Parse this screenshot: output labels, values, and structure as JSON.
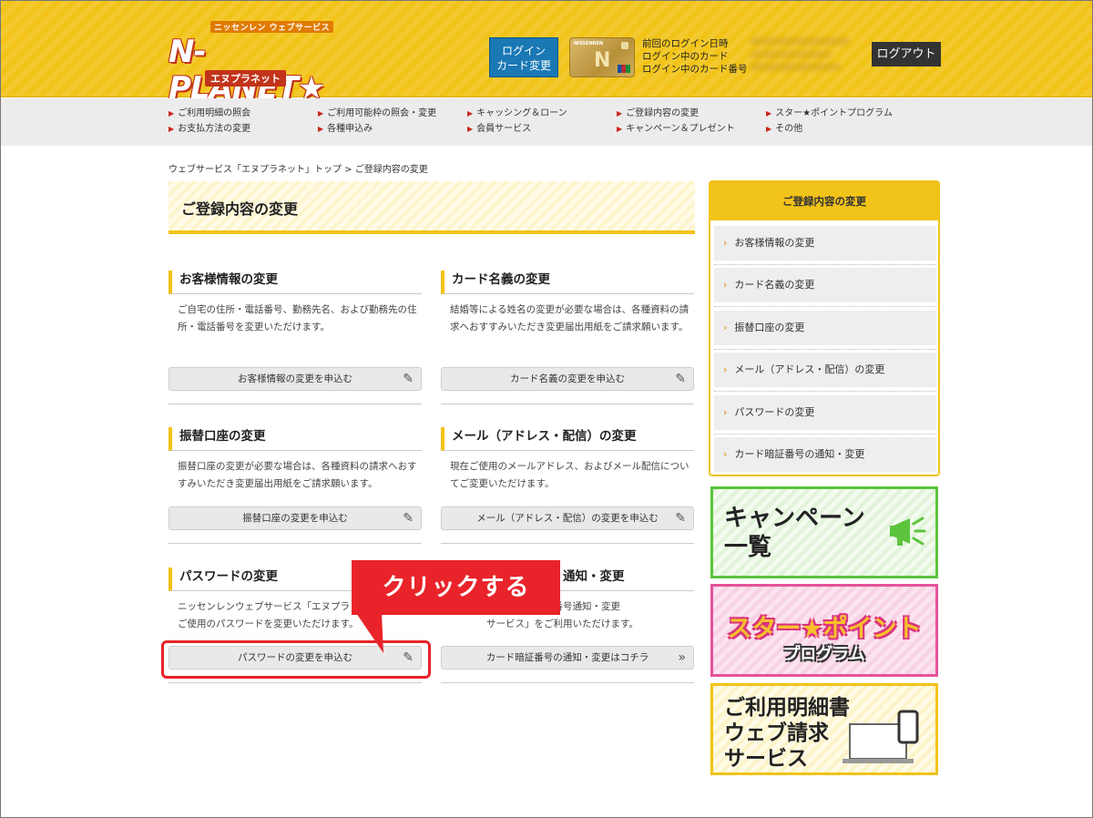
{
  "header": {
    "logo_sub": "ニッセンレン ウェブサービス",
    "logo_main": "N-PLANET★",
    "logo_kana": "エヌプラネット",
    "card_change_button": "ログイン\nカード変更",
    "card_brand": "NISSENREN",
    "login_info": [
      "前回のログイン日時",
      "ログイン中のカード",
      "ログイン中のカード番号"
    ],
    "logout_button": "ログアウト"
  },
  "nav": {
    "items": [
      "ご利用明細の照会",
      "ご利用可能枠の照会・変更",
      "キャッシング＆ローン",
      "ご登録内容の変更",
      "スター★ポイントプログラム",
      "お支払方法の変更",
      "各種申込み",
      "会員サービス",
      "キャンペーン＆プレゼント",
      "その他"
    ]
  },
  "breadcrumb": "ウェブサービス「エヌプラネット」トップ > ご登録内容の変更",
  "page_title": "ご登録内容の変更",
  "sections": [
    {
      "title": "お客様情報の変更",
      "desc": "ご自宅の住所・電話番号、勤務先名、および勤務先の住所・電話番号を変更いただけます。",
      "button": "お客様情報の変更を申込む"
    },
    {
      "title": "カード名義の変更",
      "desc": "結婚等による姓名の変更が必要な場合は、各種資料の請求へおすすみいただき変更届出用紙をご請求願います。",
      "button": "カード名義の変更を申込む"
    },
    {
      "title": "振替口座の変更",
      "desc": "振替口座の変更が必要な場合は、各種資料の請求へおすすみいただき変更届出用紙をご請求願います。",
      "button": "振替口座の変更を申込む"
    },
    {
      "title": "メール（アドレス・配信）の変更",
      "desc": "現在ご使用のメールアドレス、およびメール配信についてご変更いただけます。",
      "button": "メール（アドレス・配信）の変更を申込む"
    },
    {
      "title": "パスワードの変更",
      "desc": "ニッセンレンウェブサービス「エヌプラ\nご使用のパスワードを変更いただけます。",
      "button": "パスワードの変更を申込む"
    },
    {
      "title": "通知・変更",
      "desc": "な場合は「暗証番号通知・変更\nサービス」をご利用いただけます。",
      "button": "カード暗証番号の通知・変更はコチラ"
    }
  ],
  "sidebar": {
    "title": "ご登録内容の変更",
    "items": [
      "お客様情報の変更",
      "カード名義の変更",
      "振替口座の変更",
      "メール（アドレス・配信）の変更",
      "パスワードの変更",
      "カード暗証番号の通知・変更"
    ]
  },
  "banners": {
    "campaign": "キャンペーン\n一覧",
    "star_top": "スター★ポイント",
    "star_bottom": "プログラム",
    "bill": "ご利用明細書\nウェブ請求\nサービス"
  },
  "callout": "クリックする",
  "colors": {
    "brand_yellow": "#f2c318",
    "accent_red": "#e8242a",
    "link_blue": "#1a78b4"
  }
}
